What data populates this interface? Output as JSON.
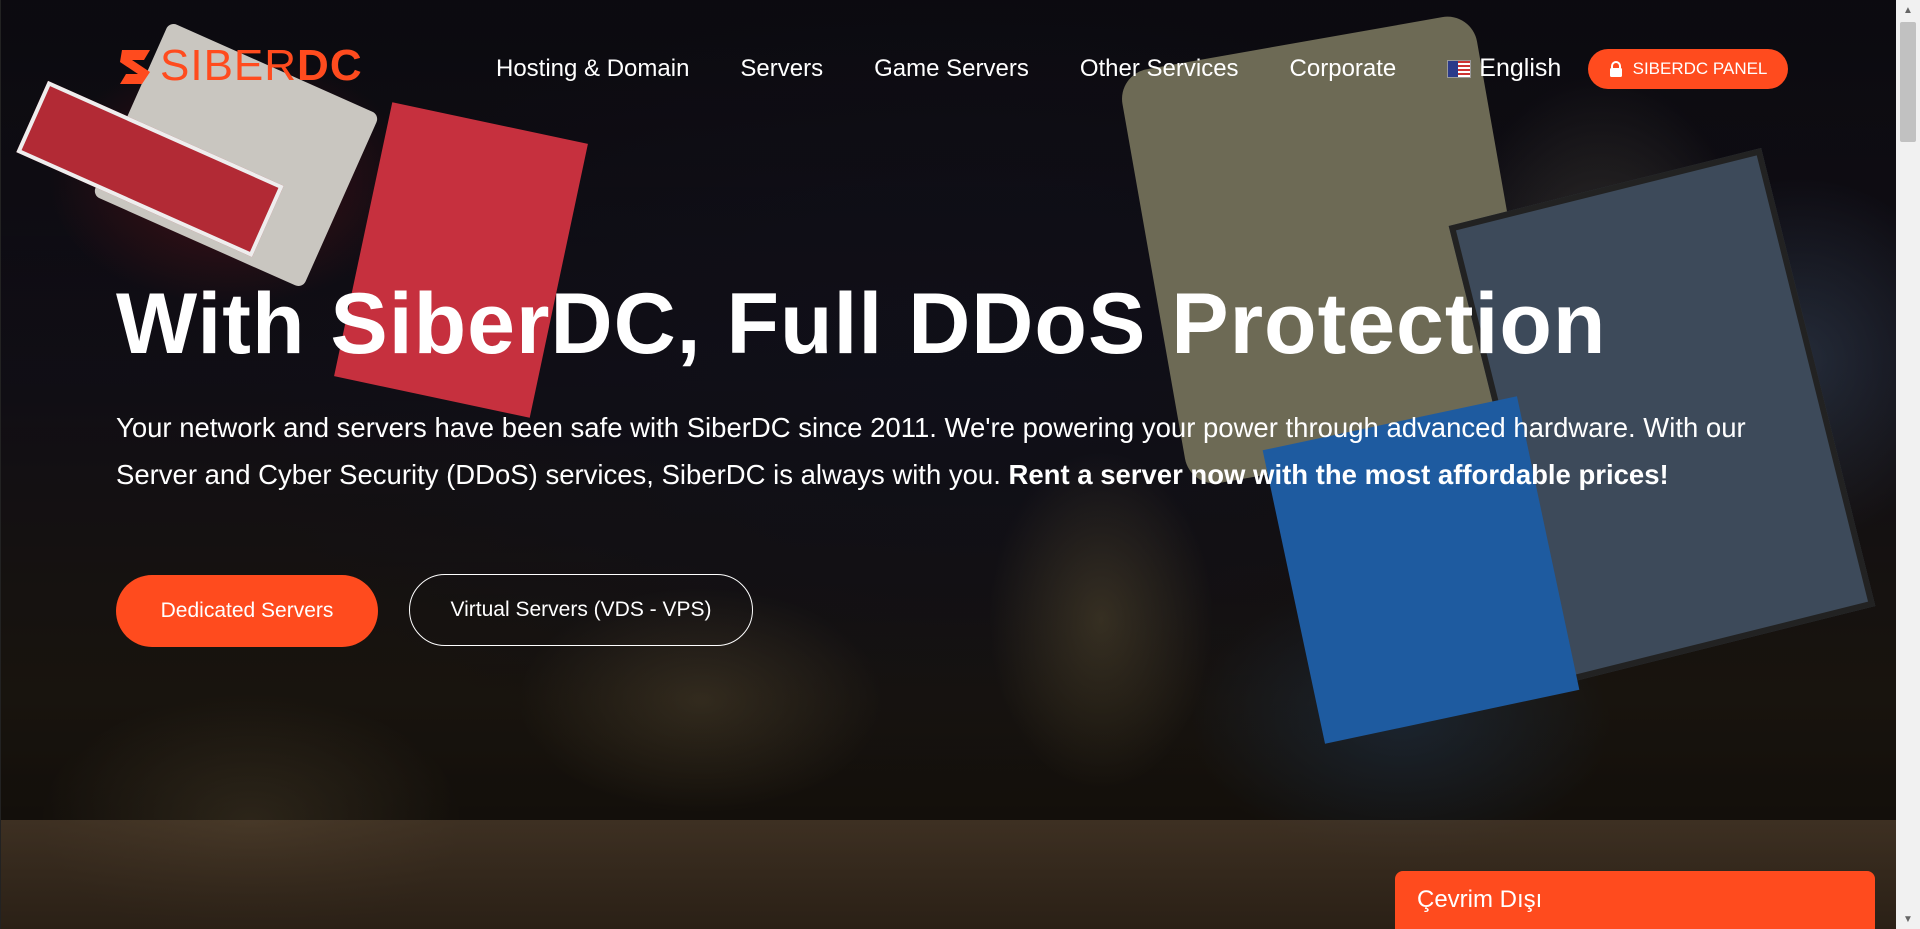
{
  "brand": {
    "logo_part1": "SIBER",
    "logo_part2": "DC",
    "accent_color": "#ff4b1e"
  },
  "nav": {
    "items": [
      {
        "label": "Hosting & Domain"
      },
      {
        "label": "Servers"
      },
      {
        "label": "Game Servers"
      },
      {
        "label": "Other Services"
      },
      {
        "label": "Corporate"
      }
    ],
    "language": {
      "label": "English",
      "icon": "us-flag-icon"
    },
    "panel_button": {
      "label": "SIBERDC PANEL",
      "icon": "lock-icon"
    }
  },
  "hero": {
    "title": "With SiberDC, Full DDoS Protection",
    "description_plain": "Your network and servers have been safe with SiberDC since 2011. We're powering your power through advanced hardware. With our Server and Cyber Security (DDoS) services, SiberDC is always with you.",
    "description_bold": "Rent a server now with the most affordable prices!",
    "primary_button": "Dedicated Servers",
    "secondary_button": "Virtual Servers (VDS - VPS)"
  },
  "chat": {
    "label": "Çevrim Dışı"
  }
}
